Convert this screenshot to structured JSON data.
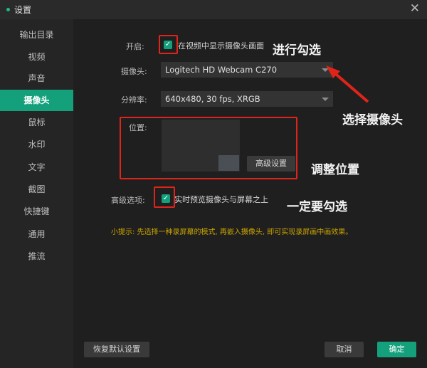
{
  "window": {
    "title": "设置"
  },
  "sidebar": {
    "items": [
      {
        "label": "输出目录"
      },
      {
        "label": "视频"
      },
      {
        "label": "声音"
      },
      {
        "label": "摄像头"
      },
      {
        "label": "鼠标"
      },
      {
        "label": "水印"
      },
      {
        "label": "文字"
      },
      {
        "label": "截图"
      },
      {
        "label": "快捷键"
      },
      {
        "label": "通用"
      },
      {
        "label": "推流"
      }
    ],
    "active_item": "摄像头"
  },
  "camera": {
    "enable_label": "开启:",
    "enable_checkbox_text": "在视频中显示摄像头画面",
    "enable_checked": true,
    "device_label": "摄像头:",
    "device_value": "Logitech HD Webcam C270",
    "resolution_label": "分辨率:",
    "resolution_value": "640x480, 30 fps, XRGB",
    "position_label": "位置:",
    "advanced_settings_button": "高级设置",
    "advanced_options_label": "高级选项:",
    "advanced_checkbox_text": "实时预览摄像头与屏幕之上",
    "advanced_checked": true,
    "tip": "小提示: 先选择一种录屏幕的模式, 再嵌入摄像头, 即可实现录屏画中画效果。"
  },
  "footer": {
    "restore_button": "恢复默认设置",
    "cancel_button": "取消",
    "ok_button": "确定"
  },
  "annotations": {
    "check_note": "进行勾选",
    "select_camera_note": "选择摄像头",
    "adjust_position_note": "调整位置",
    "must_check_note": "一定要勾选"
  },
  "colors": {
    "accent": "#15a07c",
    "annotation_red": "#e0241a",
    "tip_text": "#c9a400",
    "background": "#1f1f1f"
  }
}
